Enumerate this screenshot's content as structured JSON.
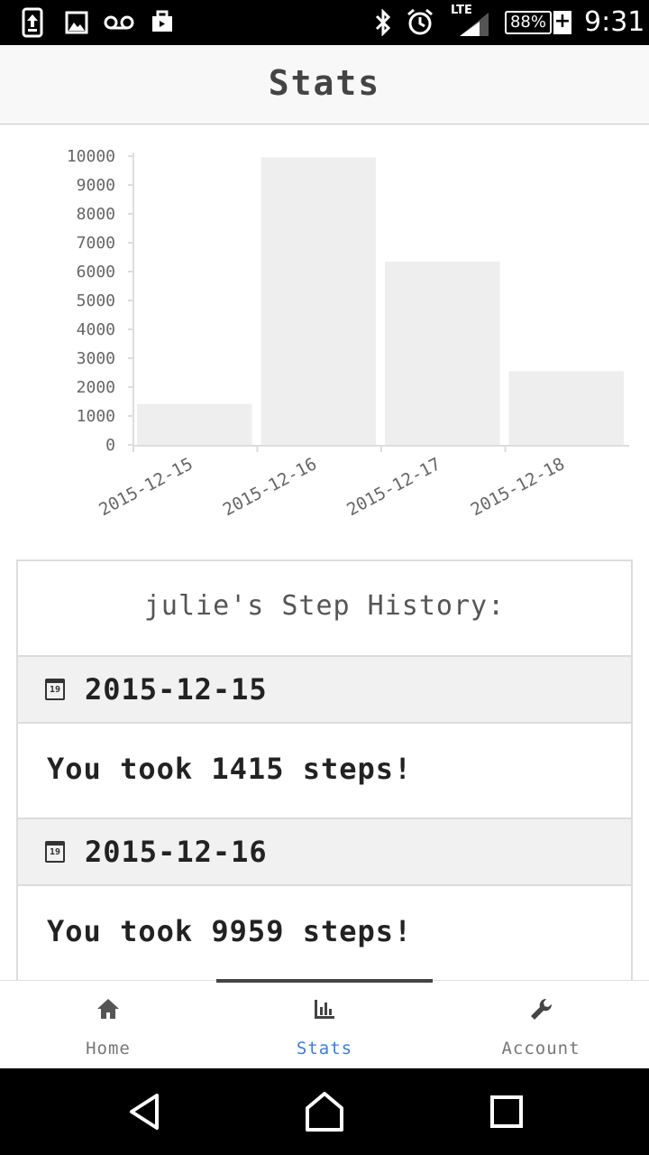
{
  "status_bar": {
    "battery_percent": "88%",
    "network": "LTE",
    "time": "9:31",
    "icons": [
      "upload-icon",
      "image-icon",
      "voicemail-icon",
      "briefcase-icon",
      "bluetooth-icon",
      "alarm-icon",
      "signal-icon",
      "battery-icon"
    ]
  },
  "header": {
    "title": "Stats"
  },
  "chart_data": {
    "type": "bar",
    "categories": [
      "2015-12-15",
      "2015-12-16",
      "2015-12-17",
      "2015-12-18"
    ],
    "values": [
      1415,
      9959,
      6350,
      2550
    ],
    "ylim": [
      0,
      10000
    ],
    "yticks": [
      0,
      1000,
      2000,
      3000,
      4000,
      5000,
      6000,
      7000,
      8000,
      9000,
      10000
    ],
    "bar_color": "#eeeeee",
    "grid": false
  },
  "history": {
    "title": "julie's Step History:",
    "entries": [
      {
        "date": "2015-12-15",
        "message": "You took 1415 steps!"
      },
      {
        "date": "2015-12-16",
        "message": "You took 9959 steps!"
      }
    ]
  },
  "tabs": [
    {
      "label": "Home",
      "icon": "home-icon",
      "active": false
    },
    {
      "label": "Stats",
      "icon": "bar-chart-icon",
      "active": true
    },
    {
      "label": "Account",
      "icon": "wrench-icon",
      "active": false
    }
  ],
  "colors": {
    "accent": "#3b7ddd",
    "header_bg": "#f8f8f8",
    "section_bg": "#f1f1f1"
  }
}
